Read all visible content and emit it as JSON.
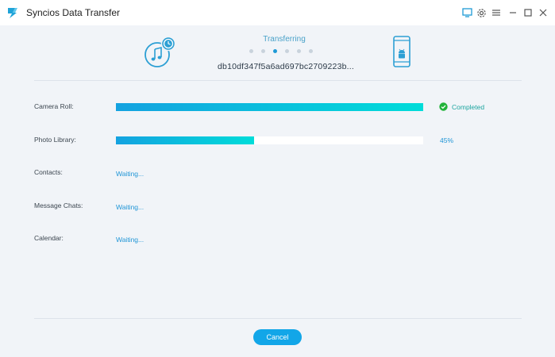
{
  "window": {
    "title": "Syncios Data Transfer",
    "icons": [
      "app-logo-icon",
      "screen-icon",
      "gear-icon",
      "menu-icon",
      "minimize-icon",
      "maximize-icon",
      "close-icon"
    ]
  },
  "transfer": {
    "status_label": "Transferring",
    "step_count": 6,
    "active_step": 3,
    "device_id": "db10df347f5a6ad697bc2709223b...",
    "source_icon": "music-icon",
    "target_icon": "android-phone-icon"
  },
  "items": [
    {
      "label": "Camera Roll:",
      "state": "completed",
      "progress": 1.0,
      "status_text": "Completed",
      "status_icon": "check-circle-icon"
    },
    {
      "label": "Photo Library:",
      "state": "in-progress",
      "progress": 0.45,
      "status_text": "45%"
    },
    {
      "label": "Contacts:",
      "state": "waiting",
      "status_text": "Waiting..."
    },
    {
      "label": "Message Chats:",
      "state": "waiting",
      "status_text": "Waiting..."
    },
    {
      "label": "Calendar:",
      "state": "waiting",
      "status_text": "Waiting..."
    }
  ],
  "footer": {
    "cancel_label": "Cancel"
  },
  "colors": {
    "accent": "#12a6e8",
    "completed": "#1ea5a0",
    "waiting": "#1f95d6",
    "background": "#f1f4f8"
  }
}
